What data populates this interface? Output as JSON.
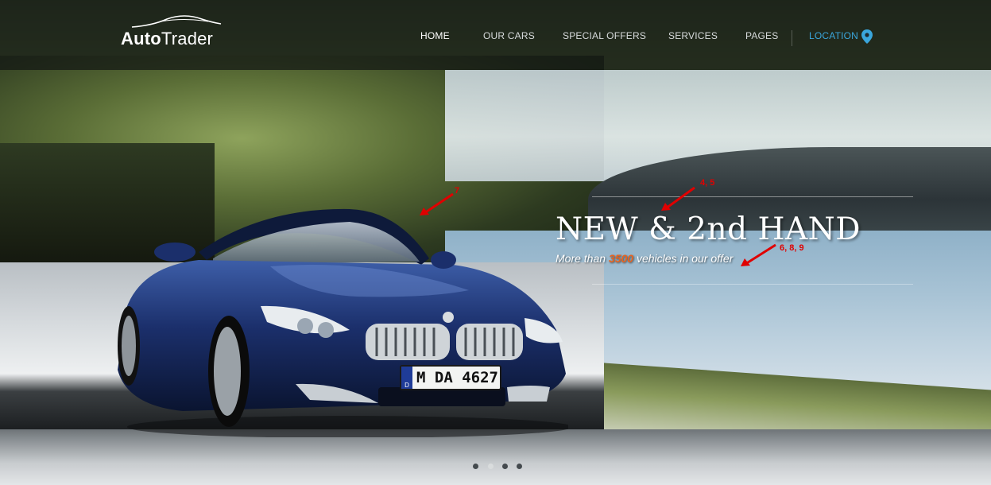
{
  "brand": {
    "name_bold": "Auto",
    "name_light": "Trader"
  },
  "nav": {
    "items": [
      {
        "label": "HOME",
        "active": true
      },
      {
        "label": "OUR CARS",
        "active": false
      },
      {
        "label": "SPECIAL OFFERS",
        "active": false
      },
      {
        "label": "SERVICES",
        "active": false
      },
      {
        "label": "PAGES",
        "active": false
      }
    ],
    "location_label": "LOCATION",
    "location_icon": "map-pin-icon"
  },
  "hero": {
    "headline": "NEW & 2nd HAND",
    "sub_prefix": "More than ",
    "sub_number": "3500",
    "sub_suffix": " vehicles in our offer",
    "plate": "M DA 4627",
    "plate_country": "D"
  },
  "annotations": [
    {
      "label": "7"
    },
    {
      "label": "4, 5"
    },
    {
      "label": "6, 8, 9"
    }
  ],
  "slider": {
    "dot_count": 4,
    "active_index": 1
  },
  "colors": {
    "accent_orange": "#e8631f",
    "location_blue": "#3aa6dc",
    "annotation_red": "#e00000",
    "car_blue": "#1b2f6b"
  }
}
